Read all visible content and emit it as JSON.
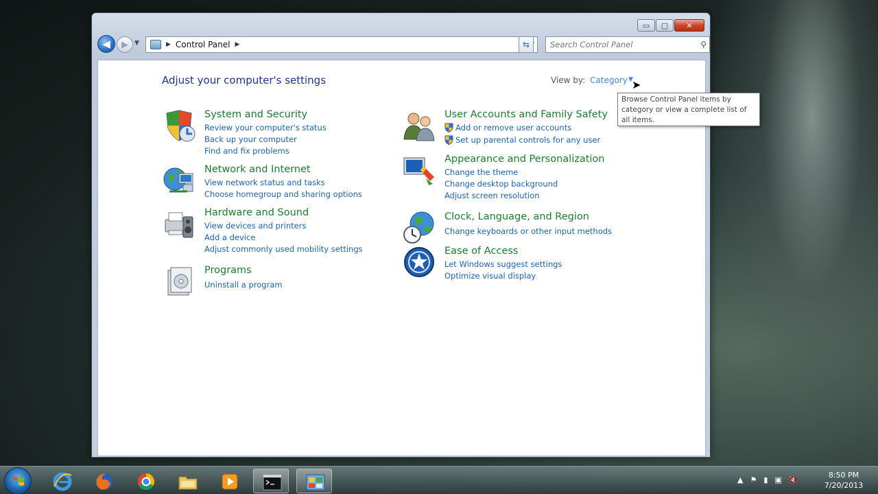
{
  "window": {
    "caption": {
      "minimize": "▭",
      "maximize": "▢",
      "close": "✕"
    },
    "breadcrumb": "Control Panel",
    "search_placeholder": "Search Control Panel"
  },
  "main": {
    "heading": "Adjust your computer's settings",
    "view_by_label": "View by:",
    "view_by_value": "Category",
    "tooltip": "Browse Control Panel items by category or view a complete list of all items."
  },
  "categories": [
    {
      "title": "System and Security",
      "icon": "shield-icon",
      "links": [
        "Review your computer's status",
        "Back up your computer",
        "Find and fix problems"
      ]
    },
    {
      "title": "Network and Internet",
      "icon": "network-globe-icon",
      "links": [
        "View network status and tasks",
        "Choose homegroup and sharing options"
      ]
    },
    {
      "title": "Hardware and Sound",
      "icon": "printer-speaker-icon",
      "links": [
        "View devices and printers",
        "Add a device",
        "Adjust commonly used mobility settings"
      ]
    },
    {
      "title": "Programs",
      "icon": "programs-box-icon",
      "links": [
        "Uninstall a program"
      ]
    },
    {
      "title": "User Accounts and Family Safety",
      "icon": "users-icon",
      "links": [
        "Add or remove user accounts",
        "Set up parental controls for any user"
      ]
    },
    {
      "title": "Appearance and Personalization",
      "icon": "monitor-paint-icon",
      "links": [
        "Change the theme",
        "Change desktop background",
        "Adjust screen resolution"
      ]
    },
    {
      "title": "Clock, Language, and Region",
      "icon": "clock-globe-icon",
      "links": [
        "Change keyboards or other input methods"
      ]
    },
    {
      "title": "Ease of Access",
      "icon": "ease-of-access-icon",
      "links": [
        "Let Windows suggest settings",
        "Optimize visual display"
      ]
    }
  ],
  "taskbar": {
    "items": [
      "start-orb",
      "internet-explorer",
      "firefox",
      "chrome",
      "windows-explorer",
      "media-player",
      "command-prompt",
      "control-panel"
    ],
    "tray_glyphs": {
      "up": "▲",
      "flag": "⚑",
      "power": "▮",
      "network": "▣",
      "volume": "🔇"
    },
    "time": "8:50 PM",
    "date": "7/20/2013"
  },
  "colors": {
    "link": "#1f62a8",
    "category_title": "#1f7a2e",
    "heading": "#1e3287"
  }
}
